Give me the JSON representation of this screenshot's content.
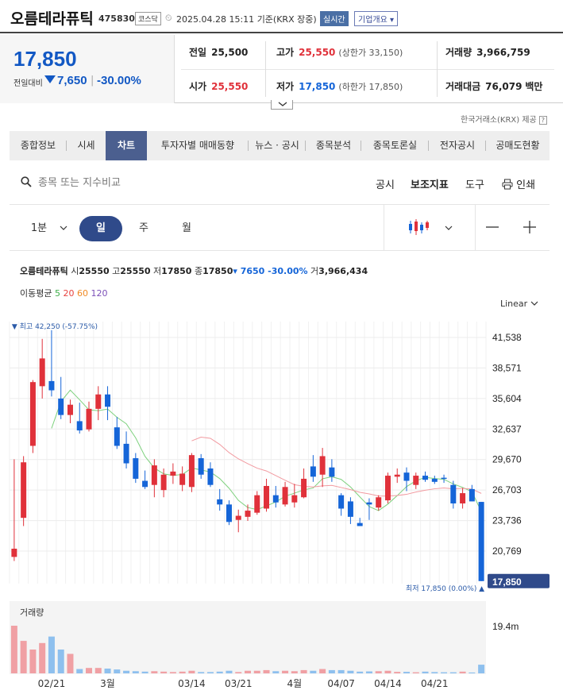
{
  "header": {
    "name": "오름테라퓨틱",
    "code": "475830",
    "market": "코스닥",
    "datetime": "2025.04.28 15:11",
    "basis": "기준(KRX 장중)",
    "live_badge": "실시간",
    "company_btn": "기업개요 ▾"
  },
  "quote": {
    "price": "17,850",
    "compare_label": "전일대비",
    "change": "7,650",
    "change_pct": "-30.00%",
    "prev_label": "전일",
    "prev": "25,500",
    "open_label": "시가",
    "open": "25,550",
    "high_label": "고가",
    "high": "25,550",
    "upper_limit": "(상한가 33,150)",
    "low_label": "저가",
    "low": "17,850",
    "lower_limit": "(하한가 17,850)",
    "volume_label": "거래량",
    "volume": "3,966,759",
    "amount_label": "거래대금",
    "amount": "76,079",
    "amount_unit": "백만"
  },
  "provider": "한국거래소(KRX) 제공",
  "tabs": [
    "종합정보",
    "시세",
    "차트",
    "투자자별 매매동향",
    "뉴스 · 공시",
    "종목분석",
    "종목토론실",
    "전자공시",
    "공매도현황"
  ],
  "active_tab": 2,
  "toolbar": {
    "search_placeholder": "종목 또는 지수비교",
    "disclosure": "공시",
    "indicator": "보조지표",
    "tools": "도구",
    "print": "인쇄"
  },
  "periods": {
    "minute": "1분",
    "day": "일",
    "week": "주",
    "month": "월"
  },
  "legend": {
    "name": "오름테라퓨틱",
    "open_label": "시",
    "open": "25550",
    "high_label": "고",
    "high": "25550",
    "low_label": "저",
    "low": "17850",
    "close_label": "종",
    "close": "17850",
    "change": "▾ 7650 -30.00%",
    "volume_label": "거",
    "volume": "3,966,434",
    "ma_label": "이동평균",
    "ma": [
      {
        "period": "5",
        "color": "#3fae49"
      },
      {
        "period": "20",
        "color": "#e8423f"
      },
      {
        "period": "60",
        "color": "#f08a24"
      },
      {
        "period": "120",
        "color": "#7b4fb8"
      }
    ]
  },
  "scale_mode": "Linear",
  "chart_data": {
    "type": "candlestick",
    "y_ticks": [
      "41,538",
      "38,571",
      "35,604",
      "32,637",
      "29,670",
      "26,703",
      "23,736",
      "20,769"
    ],
    "ylim": [
      17000,
      44000
    ],
    "last_price": "17,850",
    "max_label": "▼ 최고 42,250 (-57.75%)",
    "min_label": "최저 17,850 (0.00%) ▲",
    "x_labels": [
      "02/21",
      "3월",
      "03/14",
      "03/21",
      "4월",
      "04/07",
      "04/14",
      "04/21"
    ],
    "x_label_index": [
      4,
      10,
      19,
      24,
      30,
      35,
      40,
      45
    ],
    "volume_label": "거래량",
    "volume_tick": "19.4m",
    "volume_max": 22,
    "colors": {
      "up": "#e0313a",
      "down": "#1565d8",
      "up_vol": "#f0a0a4",
      "down_vol": "#8ec0ee",
      "ma5": "#7ed17e",
      "ma20": "#f29aa0"
    },
    "candles": [
      {
        "o": 20200,
        "h": 29700,
        "l": 19800,
        "c": 21000
      },
      {
        "o": 24000,
        "h": 30000,
        "l": 23200,
        "c": 29400
      },
      {
        "o": 31000,
        "h": 37400,
        "l": 30300,
        "c": 37200
      },
      {
        "o": 36800,
        "h": 41400,
        "l": 35600,
        "c": 39500
      },
      {
        "o": 37300,
        "h": 42250,
        "l": 35800,
        "c": 36400
      },
      {
        "o": 35600,
        "h": 37700,
        "l": 33600,
        "c": 34000
      },
      {
        "o": 34000,
        "h": 35500,
        "l": 33200,
        "c": 35000
      },
      {
        "o": 33400,
        "h": 35200,
        "l": 32200,
        "c": 32500
      },
      {
        "o": 32600,
        "h": 35300,
        "l": 32400,
        "c": 34600
      },
      {
        "o": 34600,
        "h": 36800,
        "l": 33500,
        "c": 36000
      },
      {
        "o": 36000,
        "h": 36800,
        "l": 33500,
        "c": 34800
      },
      {
        "o": 32800,
        "h": 33800,
        "l": 30700,
        "c": 31000
      },
      {
        "o": 31200,
        "h": 32400,
        "l": 28800,
        "c": 29300
      },
      {
        "o": 29800,
        "h": 30300,
        "l": 27400,
        "c": 27800
      },
      {
        "o": 27600,
        "h": 28600,
        "l": 26800,
        "c": 27000
      },
      {
        "o": 27200,
        "h": 29700,
        "l": 26000,
        "c": 29100
      },
      {
        "o": 26700,
        "h": 28800,
        "l": 26000,
        "c": 28200
      },
      {
        "o": 28100,
        "h": 29300,
        "l": 27300,
        "c": 28500
      },
      {
        "o": 27200,
        "h": 29000,
        "l": 26600,
        "c": 28300
      },
      {
        "o": 27000,
        "h": 30300,
        "l": 26500,
        "c": 30100
      },
      {
        "o": 29800,
        "h": 30200,
        "l": 27800,
        "c": 28200
      },
      {
        "o": 28800,
        "h": 29400,
        "l": 27000,
        "c": 27200
      },
      {
        "o": 25800,
        "h": 26800,
        "l": 24700,
        "c": 25300
      },
      {
        "o": 25300,
        "h": 25700,
        "l": 23300,
        "c": 23600
      },
      {
        "o": 23800,
        "h": 24800,
        "l": 22600,
        "c": 24200
      },
      {
        "o": 24100,
        "h": 25300,
        "l": 23700,
        "c": 24700
      },
      {
        "o": 24500,
        "h": 26600,
        "l": 24300,
        "c": 26200
      },
      {
        "o": 24900,
        "h": 27800,
        "l": 24600,
        "c": 27100
      },
      {
        "o": 26200,
        "h": 27100,
        "l": 25000,
        "c": 25500
      },
      {
        "o": 25300,
        "h": 27500,
        "l": 25100,
        "c": 27000
      },
      {
        "o": 25500,
        "h": 27300,
        "l": 25000,
        "c": 26200
      },
      {
        "o": 26000,
        "h": 28800,
        "l": 25900,
        "c": 27800
      },
      {
        "o": 29000,
        "h": 30100,
        "l": 27500,
        "c": 28000
      },
      {
        "o": 28200,
        "h": 30800,
        "l": 27000,
        "c": 30000
      },
      {
        "o": 28900,
        "h": 29700,
        "l": 27500,
        "c": 28000
      },
      {
        "o": 26200,
        "h": 26400,
        "l": 24200,
        "c": 24900
      },
      {
        "o": 25600,
        "h": 26000,
        "l": 23400,
        "c": 24100
      },
      {
        "o": 23500,
        "h": 24000,
        "l": 23200,
        "c": 23200
      },
      {
        "o": 25500,
        "h": 25900,
        "l": 23800,
        "c": 25300
      },
      {
        "o": 25000,
        "h": 26200,
        "l": 24700,
        "c": 26000
      },
      {
        "o": 25700,
        "h": 28400,
        "l": 25400,
        "c": 28100
      },
      {
        "o": 28000,
        "h": 28800,
        "l": 27400,
        "c": 28200
      },
      {
        "o": 28400,
        "h": 28900,
        "l": 26600,
        "c": 27600
      },
      {
        "o": 27200,
        "h": 28400,
        "l": 26800,
        "c": 28100
      },
      {
        "o": 28100,
        "h": 28500,
        "l": 27500,
        "c": 27700
      },
      {
        "o": 27800,
        "h": 28100,
        "l": 27300,
        "c": 27500
      },
      {
        "o": 27900,
        "h": 28200,
        "l": 27400,
        "c": 27800
      },
      {
        "o": 27200,
        "h": 27600,
        "l": 24900,
        "c": 25400
      },
      {
        "o": 25400,
        "h": 26900,
        "l": 24900,
        "c": 26400
      },
      {
        "o": 26800,
        "h": 27200,
        "l": 25600,
        "c": 25600
      },
      {
        "o": 25550,
        "h": 25550,
        "l": 17850,
        "c": 17850
      }
    ],
    "volumes": [
      22,
      15,
      11,
      14,
      17,
      11,
      9,
      2,
      2.5,
      2.5,
      2.2,
      1.8,
      1.2,
      1,
      0.8,
      1,
      0.8,
      0.6,
      0.8,
      1.2,
      0.6,
      0.6,
      0.8,
      1.2,
      0.6,
      1.2,
      1.2,
      1.5,
      1,
      1.2,
      1,
      1.5,
      1.2,
      2,
      1.5,
      1.5,
      1.2,
      0.8,
      0.9,
      1,
      1.2,
      0.7,
      0.7,
      0.5,
      0.8,
      0.6,
      0.5,
      0.5,
      0.8,
      0.4,
      4
    ]
  }
}
